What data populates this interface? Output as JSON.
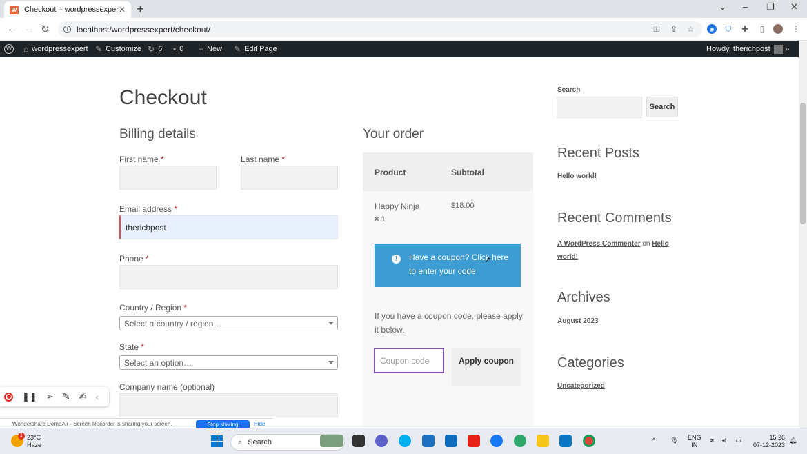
{
  "browser": {
    "tab_title": "Checkout – wordpressexpert",
    "tab_favicon": "W",
    "url": "localhost/wordpressexpert/checkout/"
  },
  "adminbar": {
    "site": "wordpressexpert",
    "customize": "Customize",
    "updates": "6",
    "comments": "0",
    "new": "New",
    "edit_page": "Edit Page",
    "howdy": "Howdy, therichpost"
  },
  "checkout": {
    "title": "Checkout",
    "billing_heading": "Billing details",
    "first_name": "First name",
    "last_name": "Last name",
    "email": "Email address",
    "email_value": "therichpost",
    "phone": "Phone",
    "country": "Country / Region",
    "country_placeholder": "Select a country / region…",
    "state": "State",
    "state_placeholder": "Select an option…",
    "company": "Company name (optional)",
    "required_mark": "*"
  },
  "order": {
    "heading": "Your order",
    "col_product": "Product",
    "col_subtotal": "Subtotal",
    "item_name": "Happy Ninja",
    "item_qty": "× 1",
    "item_price": "$18.00",
    "coupon_notice_a": "Have a coupon?",
    "coupon_notice_b": "Click here to enter your code",
    "coupon_help": "If you have a coupon code, please apply it below.",
    "coupon_placeholder": "Coupon code",
    "apply_label": "Apply coupon"
  },
  "sidebar": {
    "search_label": "Search",
    "search_button": "Search",
    "recent_posts": "Recent Posts",
    "post_1": "Hello world!",
    "recent_comments": "Recent Comments",
    "commenter": "A WordPress Commenter",
    "on": "on",
    "comment_post": "Hello world!",
    "archives": "Archives",
    "archive_1": "August 2023",
    "categories": "Categories",
    "category_1": "Uncategorized"
  },
  "sharebar": {
    "text": "Wondershare DemoAir - Screen Recorder is sharing your screen.",
    "stop": "Stop sharing",
    "hide": "Hide"
  },
  "taskbar": {
    "temp": "23°C",
    "weather": "Haze",
    "search": "Search",
    "lang_1": "ENG",
    "lang_2": "IN",
    "time": "15:26",
    "date": "07-12-2023"
  },
  "colors": {
    "accent": "#3d9cd2",
    "adminbar": "#1d2327",
    "required": "#b22222",
    "coupon_border": "#7f54b3"
  }
}
